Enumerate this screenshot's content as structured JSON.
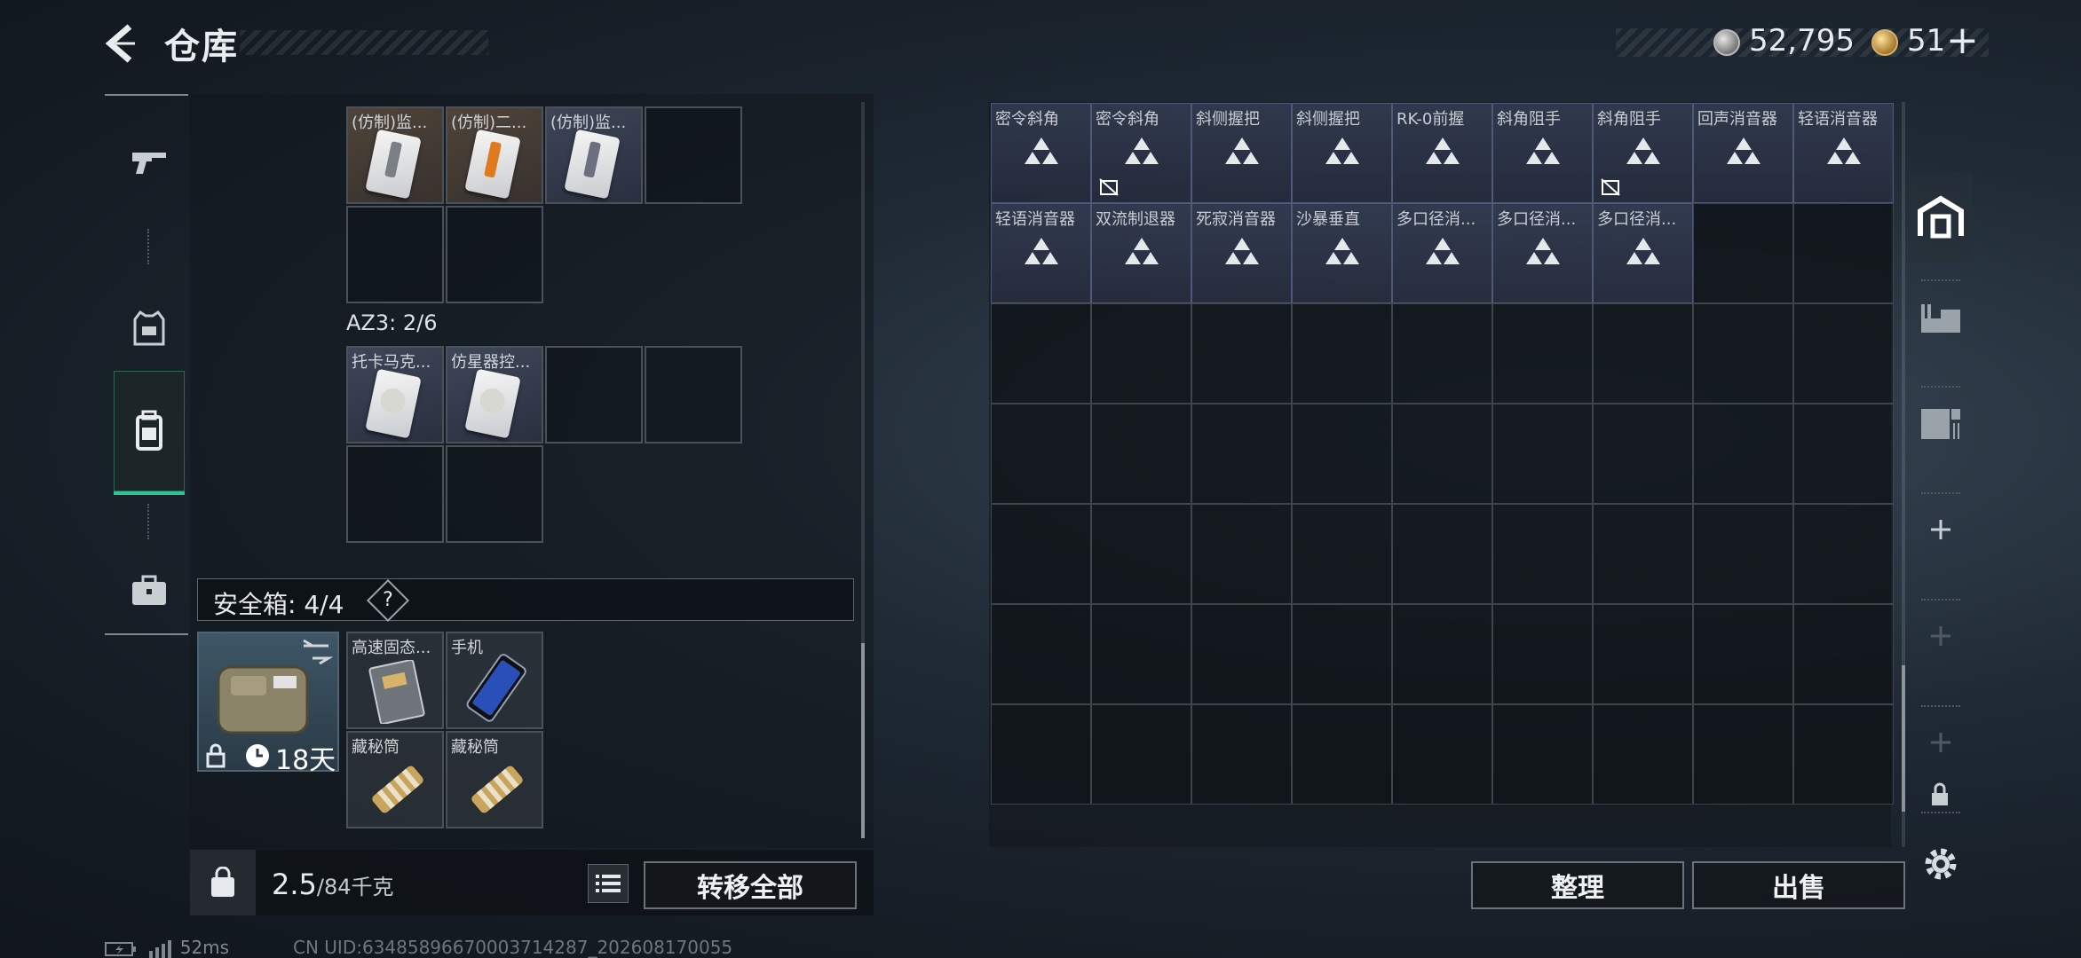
{
  "header": {
    "title": "仓库",
    "currency_silver": "52,795",
    "currency_gold": "51",
    "add_symbol": "+"
  },
  "left_tabs": [
    {
      "name": "weapons",
      "icon": "gun-icon"
    },
    {
      "name": "gear",
      "icon": "vest-icon"
    },
    {
      "name": "backpack",
      "icon": "backpack-icon",
      "active": true
    },
    {
      "name": "case",
      "icon": "briefcase-icon"
    }
  ],
  "container_a": {
    "items": [
      "(仿制)监...",
      "(仿制)二...",
      "(仿制)监..."
    ]
  },
  "container_az3": {
    "label": "AZ3: 2/6",
    "items": [
      "托卡马克...",
      "仿星器控..."
    ]
  },
  "safe_box": {
    "label": "安全箱: 4/4",
    "help": "?",
    "days": "18天",
    "items": [
      "高速固态...",
      "手机",
      "藏秘筒",
      "藏秘筒"
    ]
  },
  "weight": {
    "current": "2.5",
    "max": "/84千克"
  },
  "buttons": {
    "transfer_all": "转移全部",
    "sort": "整理",
    "sell": "出售"
  },
  "stash_items": [
    "密令斜角",
    "密令斜角",
    "斜侧握把",
    "斜侧握把",
    "RK-0前握",
    "斜角阻手",
    "斜角阻手",
    "回声消音器",
    "轻语消音器",
    "轻语消音器",
    "双流制退器",
    "死寂消音器",
    "沙暴垂直",
    "多口径消...",
    "多口径消...",
    "多口径消..."
  ],
  "status": {
    "ping": "52ms",
    "uid": "CN UID:63485896670003714287_202608170055"
  },
  "colors": {
    "accent_green": "#2ac88e",
    "item_blue": "#444e6e",
    "item_brown": "#96765a"
  }
}
